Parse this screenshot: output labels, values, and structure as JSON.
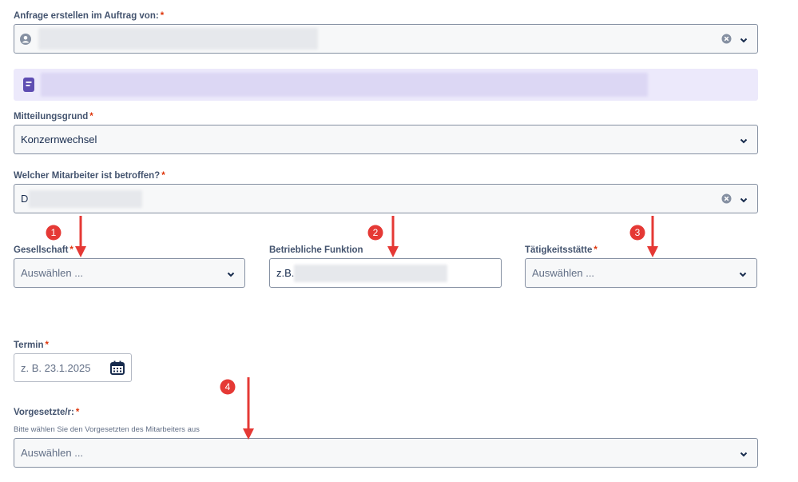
{
  "form": {
    "requester": {
      "label": "Anfrage erstellen im Auftrag von:",
      "required": "*"
    },
    "reason": {
      "label": "Mitteilungsgrund",
      "required": "*",
      "value": "Konzernwechsel"
    },
    "employee": {
      "label": "Welcher Mitarbeiter ist betroffen?",
      "required": "*",
      "value": "D"
    },
    "company": {
      "label": "Gesellschaft",
      "required": "*",
      "placeholder": "Auswählen ..."
    },
    "function": {
      "label": "Betriebliche Funktion",
      "value": "z.B. ."
    },
    "location": {
      "label": "Tätigkeitsstätte",
      "required": "*",
      "placeholder": "Auswählen ..."
    },
    "date": {
      "label": "Termin",
      "required": "*",
      "placeholder": "z. B. 23.1.2025"
    },
    "supervisor": {
      "label": "Vorgesetzte/r:",
      "required": "*",
      "hint": "Bitte wählen Sie den Vorgesetzten des Mitarbeiters aus",
      "placeholder": "Auswählen ..."
    }
  },
  "annotations": {
    "badge1": "1",
    "badge2": "2",
    "badge3": "3",
    "badge4": "4"
  },
  "icons": {
    "user": "person-avatar-icon",
    "form": "form-document-icon",
    "clear": "clear-x-icon",
    "chevron": "chevron-down-icon",
    "calendar": "calendar-icon"
  },
  "colors": {
    "accent": "#5e4db2",
    "banner": "#ece9fb",
    "required": "#de350b",
    "annotation": "#e53935"
  }
}
